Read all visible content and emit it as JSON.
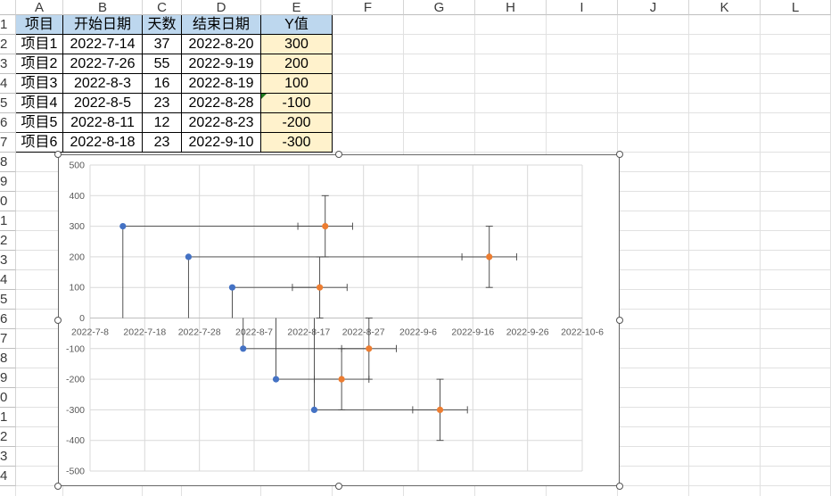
{
  "sheet": {
    "columns": [
      "A",
      "B",
      "C",
      "D",
      "E",
      "F",
      "G",
      "H",
      "I",
      "J",
      "K",
      "L"
    ],
    "rows": [
      "1",
      "2",
      "3",
      "4",
      "5",
      "6",
      "7",
      "8",
      "9",
      "0",
      "1",
      "2",
      "3",
      "4",
      "5",
      "6",
      "7",
      "8",
      "9",
      "0",
      "1",
      "2",
      "3",
      "4"
    ],
    "table": {
      "headers": [
        "项目",
        "开始日期",
        "天数",
        "结束日期",
        "Y值"
      ],
      "rows": [
        [
          "项目1",
          "2022-7-14",
          "37",
          "2022-8-20",
          "300"
        ],
        [
          "项目2",
          "2022-7-26",
          "55",
          "2022-9-19",
          "200"
        ],
        [
          "项目3",
          "2022-8-3",
          "16",
          "2022-8-19",
          "100"
        ],
        [
          "项目4",
          "2022-8-5",
          "23",
          "2022-8-28",
          "-100"
        ],
        [
          "项目5",
          "2022-8-11",
          "12",
          "2022-8-23",
          "-200"
        ],
        [
          "项目6",
          "2022-8-18",
          "23",
          "2022-9-10",
          "-300"
        ]
      ]
    }
  },
  "colors": {
    "start_point": "#4472c4",
    "end_point": "#ed7d31",
    "error_bar": "#404040",
    "header_fill": "#bdd7ee",
    "yvalue_fill": "#fff2cc"
  },
  "chart_data": {
    "type": "scatter",
    "x_axis": {
      "type": "date",
      "min": "2022-7-8",
      "max": "2022-10-6",
      "ticks": [
        "2022-7-8",
        "2022-7-18",
        "2022-7-28",
        "2022-8-7",
        "2022-8-17",
        "2022-8-27",
        "2022-9-6",
        "2022-9-16",
        "2022-9-26",
        "2022-10-6"
      ]
    },
    "y_axis": {
      "min": -500,
      "max": 500,
      "ticks": [
        "500",
        "400",
        "300",
        "200",
        "100",
        "0",
        "-100",
        "-200",
        "-300",
        "-400",
        "-500"
      ]
    },
    "grid": true,
    "series": [
      {
        "points": [
          {
            "x": "2022-7-14",
            "y": 300
          },
          {
            "x": "2022-7-26",
            "y": 200
          },
          {
            "x": "2022-8-3",
            "y": 100
          },
          {
            "x": "2022-8-5",
            "y": -100
          },
          {
            "x": "2022-8-11",
            "y": -200
          },
          {
            "x": "2022-8-18",
            "y": -300
          }
        ],
        "x_error_plus_days": [
          37,
          55,
          16,
          23,
          12,
          23
        ]
      },
      {
        "points": [
          {
            "x": "2022-8-20",
            "y": 300
          },
          {
            "x": "2022-9-19",
            "y": 200
          },
          {
            "x": "2022-8-19",
            "y": 100
          },
          {
            "x": "2022-8-28",
            "y": -100
          },
          {
            "x": "2022-8-23",
            "y": -200
          },
          {
            "x": "2022-9-10",
            "y": -300
          }
        ],
        "x_error_days": 5,
        "y_error": 100
      }
    ]
  }
}
